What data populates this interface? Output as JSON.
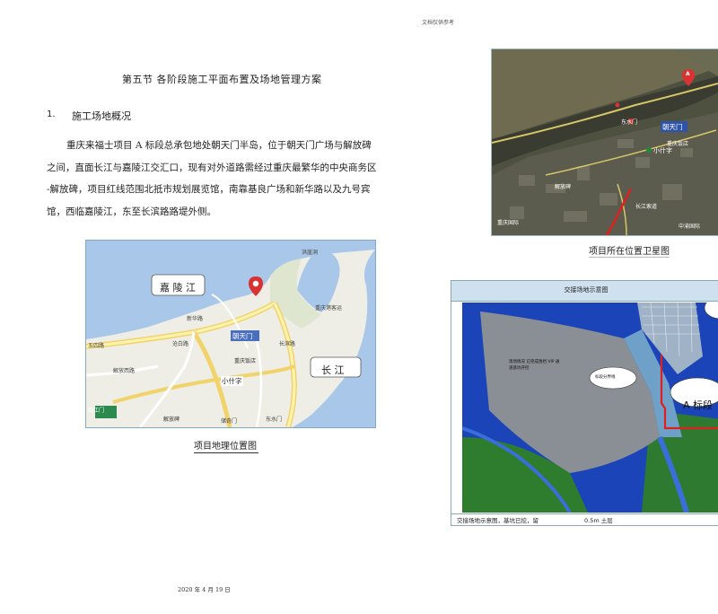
{
  "header_note": "文档仅供参考",
  "section_title": "第五节    各阶段施工平面布置及场地管理方案",
  "heading1": {
    "num": "1.",
    "text": "施工场地概况"
  },
  "paragraph_lines": [
    "重庆来福士项目   A 标段总承包地处朝天门半岛，位于朝天门广场与解放碑",
    "之间，直面长江与嘉陵江交汇口，现有对外道路需经过重庆最繁华的中央商务区",
    "-解放碑，项目红线范围北抵市规划展览馆，南靠基良广场和新华路以及九号宾",
    "馆，西临嘉陵江，东至长滨路路堤外侧。"
  ],
  "map1": {
    "river_left": "嘉 陵 江",
    "river_right": "长 江",
    "marker": "A",
    "labels": {
      "chaotianmen": "朝天门",
      "xiaoshizi": "小什字",
      "chongqing_hotel": "重庆饭店",
      "jiefang_tower": "解放碑",
      "linjiangmen": "临江门",
      "wuyi_road": "五四路",
      "cangbai_road": "沧白路",
      "dongshui_gate": "东水门",
      "xinhua_road": "新华路",
      "jiefangxi_road": "解放西路",
      "chongqing_port": "重庆港客运",
      "hongyadong": "洪崖洞",
      "cuiyu_road": "储奇门",
      "changbin_road": "长滨路"
    },
    "caption": "项目地理位置图"
  },
  "satellite": {
    "marker": "A",
    "label_main": "朝天门",
    "labels": {
      "xiaoshizi": "小什字",
      "dongshuimen": "东水门",
      "hotel": "重庆饭店",
      "changjiang": "长江索道",
      "jiefangbei": "解放碑",
      "cbd": "中渝国际",
      "guoji": "重庆国际"
    },
    "caption": "项目所在位置卫星图"
  },
  "diagram": {
    "title": "交接场地示意图",
    "a_label": "A 标段",
    "note_left": "现场情况  已完成围挡  VIP  通道基坑开挖",
    "bubble_small": "标段分界线",
    "caption_parts": [
      "交接场地示意图，基坑已挖，留",
      "0.5m 土层"
    ],
    "accent": "#e02020"
  },
  "footer_date": "2020 年 4 月 19 日"
}
